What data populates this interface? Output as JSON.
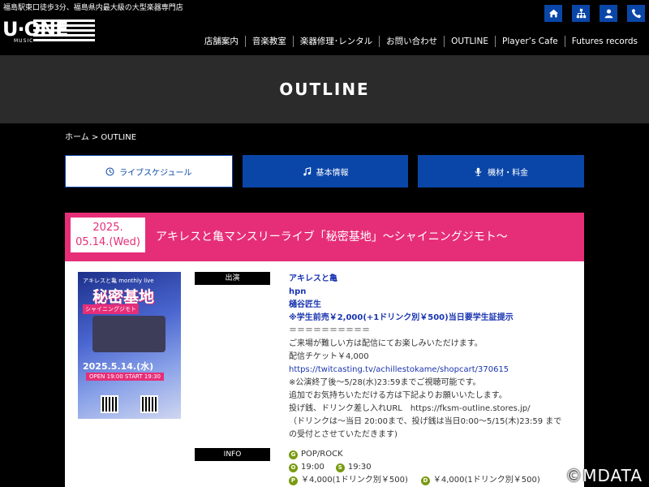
{
  "header": {
    "tagline": "福島駅東口徒歩3分、福島県内最大級の大型楽器専門店",
    "logo_main": "U·ONE",
    "logo_sub": "MUSIC",
    "icons": [
      "home-icon",
      "sitemap-icon",
      "user-icon",
      "phone-icon"
    ],
    "accent": "#0a46a8"
  },
  "nav": {
    "items": [
      {
        "label": "店舗案内"
      },
      {
        "label": "音楽教室"
      },
      {
        "label": "楽器修理･レンタル"
      },
      {
        "label": "お問い合わせ"
      },
      {
        "label": "OUTLINE"
      },
      {
        "label": "Player’s Cafe"
      },
      {
        "label": "Futures records"
      }
    ]
  },
  "hero": {
    "title": "OUTLINE"
  },
  "breadcrumb": "ホーム > OUTLINE",
  "tabs": [
    {
      "label": "ライブスケジュール",
      "icon": "clock-icon",
      "active": true
    },
    {
      "label": "基本情報",
      "icon": "music-note-icon",
      "active": false
    },
    {
      "label": "機材・料金",
      "icon": "microphone-icon",
      "active": false
    }
  ],
  "event": {
    "date_line1": "2025.",
    "date_line2": "05.14.(Wed)",
    "title": "アキレスと亀マンスリーライブ「秘密基地」～シャイニングジモト～",
    "head_color": "#e62e78",
    "poster": {
      "line1": "アキレスと亀 monthly live",
      "title": "秘密基地",
      "subtitle": "シャイニングジモト",
      "date": "2025.5.14.(水)",
      "time": "OPEN 19:00  START 19:30"
    },
    "performer_label": "出演",
    "performers": [
      "アキレスと亀",
      "hpn",
      "樋谷匠生"
    ],
    "price_note": "※学生前売￥2,000(+1ドリンク別￥500)当日要学生証提示",
    "details": [
      "＝＝＝＝＝＝＝＝＝＝",
      "ご来場が難しい方は配信にてお楽しみいただけます。",
      "配信チケット￥4,000",
      "https://twitcasting.tv/achillestokame/shopcart/370615",
      "※公演終了後～5/28(水)23:59までご視聴可能です。",
      "追加でお気持ちいただける方は下記よりお願いいたします。",
      "投げ銭、ドリンク差し入れURL　https://fksm-outline.stores.jp/",
      "（ドリンクは～当日 20:00まで、投げ銭は当日0:00～5/15(木)23:59 まで",
      "の受付とさせていただきます)"
    ],
    "info_label": "INFO",
    "genre": "POP/ROCK",
    "open": "19:00",
    "start": "19:30",
    "price_pre": "￥4,000(1ドリンク別￥500)",
    "price_door": "￥4,000(1ドリンク別￥500)"
  },
  "watermark": "©MDATA"
}
